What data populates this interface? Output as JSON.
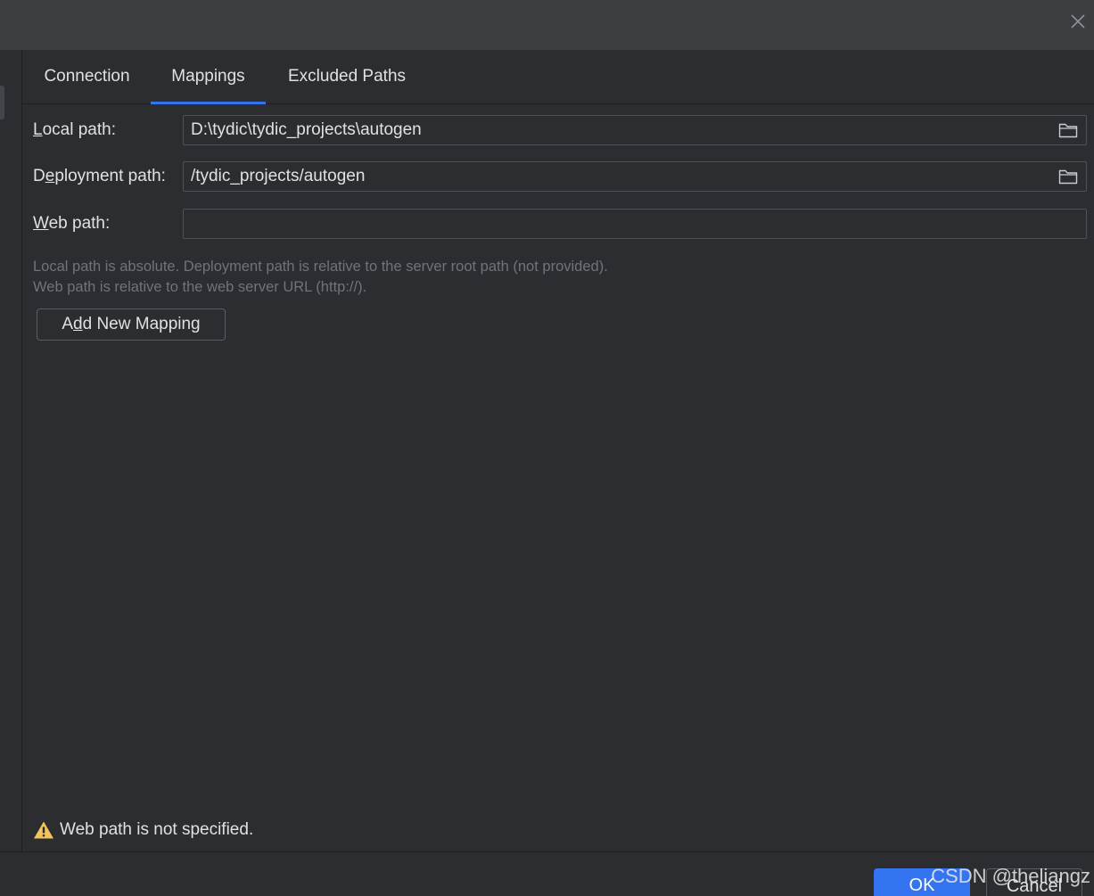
{
  "title_bar": {
    "close_icon": "close-icon"
  },
  "tabs": [
    {
      "label": "Connection",
      "active": false
    },
    {
      "label": "Mappings",
      "active": true
    },
    {
      "label": "Excluded Paths",
      "active": false
    }
  ],
  "mapping": {
    "local_path": {
      "label_mnemonic": "L",
      "label_rest": "ocal path:",
      "value": "D:\\tydic\\tydic_projects\\autogen",
      "icon": "folder-icon"
    },
    "deployment_path": {
      "label_pre": "D",
      "label_mnemonic": "e",
      "label_rest": "ployment path:",
      "value": "/tydic_projects/autogen",
      "icon": "folder-icon"
    },
    "web_path": {
      "label_mnemonic": "W",
      "label_rest": "eb path:",
      "value": ""
    }
  },
  "hints": {
    "line1": "Local path is absolute. Deployment path is relative to the server root path (not provided).",
    "line2": "Web path is relative to the web server URL (http://)."
  },
  "add_mapping_button": {
    "pre": "A",
    "mnemonic": "d",
    "rest": "d New Mapping"
  },
  "warning": {
    "icon": "warning-icon",
    "text": "Web path is not specified.",
    "icon_color": "#f2c55c"
  },
  "footer": {
    "ok_label": "OK",
    "cancel_label": "Cancel"
  },
  "watermark": "CSDN @theliangz",
  "colors": {
    "accent": "#3574f0",
    "background": "#2b2d30",
    "title_bar": "#3c3f41"
  }
}
